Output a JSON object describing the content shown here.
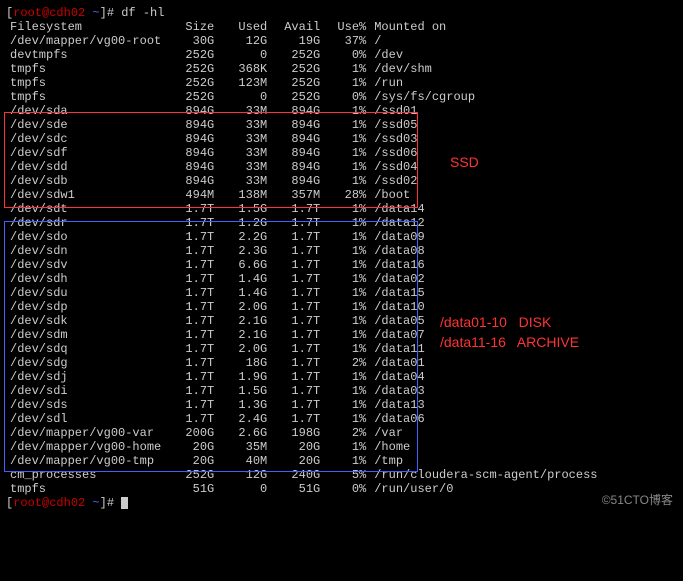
{
  "prompt": {
    "user": "root@cdh02",
    "path": "~",
    "symbol": "]#",
    "command": "df -hl"
  },
  "header": {
    "fs": "Filesystem",
    "size": "Size",
    "used": "Used",
    "avail": "Avail",
    "usep": "Use%",
    "mount": "Mounted on"
  },
  "rows": [
    {
      "fs": "/dev/mapper/vg00-root",
      "size": "30G",
      "used": "12G",
      "avail": "19G",
      "usep": "37%",
      "mount": "/"
    },
    {
      "fs": "devtmpfs",
      "size": "252G",
      "used": "0",
      "avail": "252G",
      "usep": "0%",
      "mount": "/dev"
    },
    {
      "fs": "tmpfs",
      "size": "252G",
      "used": "368K",
      "avail": "252G",
      "usep": "1%",
      "mount": "/dev/shm"
    },
    {
      "fs": "tmpfs",
      "size": "252G",
      "used": "123M",
      "avail": "252G",
      "usep": "1%",
      "mount": "/run"
    },
    {
      "fs": "tmpfs",
      "size": "252G",
      "used": "0",
      "avail": "252G",
      "usep": "0%",
      "mount": "/sys/fs/cgroup"
    },
    {
      "fs": "/dev/sda",
      "size": "894G",
      "used": "33M",
      "avail": "894G",
      "usep": "1%",
      "mount": "/ssd01"
    },
    {
      "fs": "/dev/sde",
      "size": "894G",
      "used": "33M",
      "avail": "894G",
      "usep": "1%",
      "mount": "/ssd05"
    },
    {
      "fs": "/dev/sdc",
      "size": "894G",
      "used": "33M",
      "avail": "894G",
      "usep": "1%",
      "mount": "/ssd03"
    },
    {
      "fs": "/dev/sdf",
      "size": "894G",
      "used": "33M",
      "avail": "894G",
      "usep": "1%",
      "mount": "/ssd06"
    },
    {
      "fs": "/dev/sdd",
      "size": "894G",
      "used": "33M",
      "avail": "894G",
      "usep": "1%",
      "mount": "/ssd04"
    },
    {
      "fs": "/dev/sdb",
      "size": "894G",
      "used": "33M",
      "avail": "894G",
      "usep": "1%",
      "mount": "/ssd02"
    },
    {
      "fs": "/dev/sdw1",
      "size": "494M",
      "used": "138M",
      "avail": "357M",
      "usep": "28%",
      "mount": "/boot"
    },
    {
      "fs": "/dev/sdt",
      "size": "1.7T",
      "used": "1.5G",
      "avail": "1.7T",
      "usep": "1%",
      "mount": "/data14"
    },
    {
      "fs": "/dev/sdr",
      "size": "1.7T",
      "used": "1.2G",
      "avail": "1.7T",
      "usep": "1%",
      "mount": "/data12"
    },
    {
      "fs": "/dev/sdo",
      "size": "1.7T",
      "used": "2.2G",
      "avail": "1.7T",
      "usep": "1%",
      "mount": "/data09"
    },
    {
      "fs": "/dev/sdn",
      "size": "1.7T",
      "used": "2.3G",
      "avail": "1.7T",
      "usep": "1%",
      "mount": "/data08"
    },
    {
      "fs": "/dev/sdv",
      "size": "1.7T",
      "used": "6.6G",
      "avail": "1.7T",
      "usep": "1%",
      "mount": "/data16"
    },
    {
      "fs": "/dev/sdh",
      "size": "1.7T",
      "used": "1.4G",
      "avail": "1.7T",
      "usep": "1%",
      "mount": "/data02"
    },
    {
      "fs": "/dev/sdu",
      "size": "1.7T",
      "used": "1.4G",
      "avail": "1.7T",
      "usep": "1%",
      "mount": "/data15"
    },
    {
      "fs": "/dev/sdp",
      "size": "1.7T",
      "used": "2.0G",
      "avail": "1.7T",
      "usep": "1%",
      "mount": "/data10"
    },
    {
      "fs": "/dev/sdk",
      "size": "1.7T",
      "used": "2.1G",
      "avail": "1.7T",
      "usep": "1%",
      "mount": "/data05"
    },
    {
      "fs": "/dev/sdm",
      "size": "1.7T",
      "used": "2.1G",
      "avail": "1.7T",
      "usep": "1%",
      "mount": "/data07"
    },
    {
      "fs": "/dev/sdq",
      "size": "1.7T",
      "used": "2.0G",
      "avail": "1.7T",
      "usep": "1%",
      "mount": "/data11"
    },
    {
      "fs": "/dev/sdg",
      "size": "1.7T",
      "used": "18G",
      "avail": "1.7T",
      "usep": "2%",
      "mount": "/data01"
    },
    {
      "fs": "/dev/sdj",
      "size": "1.7T",
      "used": "1.9G",
      "avail": "1.7T",
      "usep": "1%",
      "mount": "/data04"
    },
    {
      "fs": "/dev/sdi",
      "size": "1.7T",
      "used": "1.5G",
      "avail": "1.7T",
      "usep": "1%",
      "mount": "/data03"
    },
    {
      "fs": "/dev/sds",
      "size": "1.7T",
      "used": "1.3G",
      "avail": "1.7T",
      "usep": "1%",
      "mount": "/data13"
    },
    {
      "fs": "/dev/sdl",
      "size": "1.7T",
      "used": "2.4G",
      "avail": "1.7T",
      "usep": "1%",
      "mount": "/data06"
    },
    {
      "fs": "/dev/mapper/vg00-var",
      "size": "200G",
      "used": "2.6G",
      "avail": "198G",
      "usep": "2%",
      "mount": "/var"
    },
    {
      "fs": "/dev/mapper/vg00-home",
      "size": "20G",
      "used": "35M",
      "avail": "20G",
      "usep": "1%",
      "mount": "/home"
    },
    {
      "fs": "/dev/mapper/vg00-tmp",
      "size": "20G",
      "used": "40M",
      "avail": "20G",
      "usep": "1%",
      "mount": "/tmp"
    },
    {
      "fs": "cm_processes",
      "size": "252G",
      "used": "12G",
      "avail": "240G",
      "usep": "5%",
      "mount": "/run/cloudera-scm-agent/process"
    },
    {
      "fs": "tmpfs",
      "size": "51G",
      "used": "0",
      "avail": "51G",
      "usep": "0%",
      "mount": "/run/user/0"
    }
  ],
  "annotations": {
    "ssd": "SSD",
    "disk_line1": "/data01-10   DISK",
    "disk_line2": "/data11-16   ARCHIVE"
  },
  "watermark": "©51CTO博客"
}
